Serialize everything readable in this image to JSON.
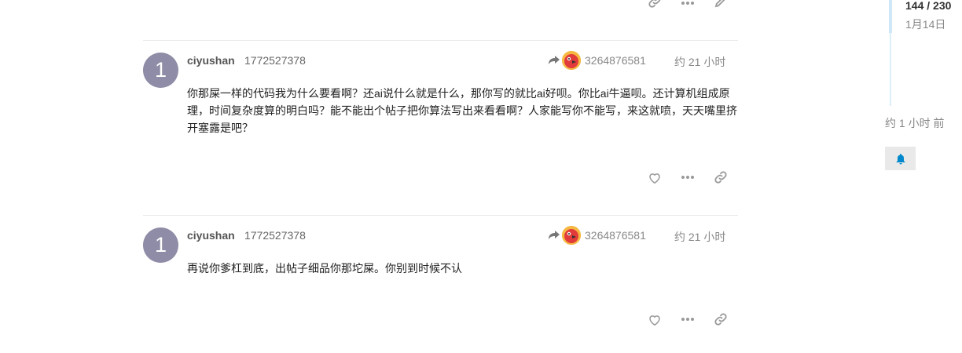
{
  "posts": [
    {
      "avatar_text": "1",
      "username": "ciyushan",
      "user_id": "1772527378",
      "reply_to": "3264876581",
      "time": "约 21 小时",
      "body": "你那屎一样的代码我为什么要看啊？还ai说什么就是什么，那你写的就比ai好呗。你比ai牛逼呗。还计算机组成原理，时间复杂度算的明白吗？能不能出个帖子把你算法写出来看看啊？人家能写你不能写，来这就喷，天天嘴里挤开塞露是吧？"
    },
    {
      "avatar_text": "1",
      "username": "ciyushan",
      "user_id": "1772527378",
      "reply_to": "3264876581",
      "time": "约 21 小时",
      "body": "再说你爹杠到底，出帖子细品你那坨屎。你别到时候不认"
    }
  ],
  "timeline": {
    "count": "144 / 230",
    "date": "1月14日",
    "bottom_label": "约 1 小时 前"
  },
  "icons": {
    "like": "heart-icon",
    "more": "ellipsis-icon",
    "link": "link-icon",
    "edit": "pencil-icon",
    "reply": "reply-arrow-icon",
    "bell": "bell-icon"
  },
  "colors": {
    "avatar_bg": "#8e8ca6",
    "bell": "#0088cc",
    "muted": "#888888"
  }
}
